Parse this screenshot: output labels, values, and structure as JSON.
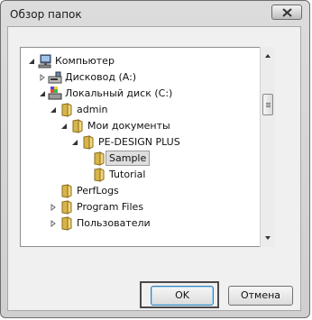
{
  "window": {
    "title": "Обзор папок",
    "close_icon": "close-icon"
  },
  "tree": {
    "items": [
      {
        "label": "Компьютер",
        "icon": "computer-icon",
        "expander": "expanded"
      },
      {
        "label": "Дисковод (A:)",
        "icon": "floppy-drive-icon",
        "expander": "collapsed"
      },
      {
        "label": "Локальный диск (C:)",
        "icon": "hard-drive-icon",
        "expander": "expanded"
      },
      {
        "label": "admin",
        "icon": "folder-icon",
        "expander": "expanded"
      },
      {
        "label": "Мои документы",
        "icon": "folder-icon",
        "expander": "expanded"
      },
      {
        "label": "PE-DESIGN PLUS",
        "icon": "folder-icon",
        "expander": "expanded"
      },
      {
        "label": "Sample",
        "icon": "folder-icon",
        "expander": "none",
        "selected": true
      },
      {
        "label": "Tutorial",
        "icon": "folder-icon",
        "expander": "none"
      },
      {
        "label": "PerfLogs",
        "icon": "folder-icon",
        "expander": "none"
      },
      {
        "label": "Program Files",
        "icon": "folder-icon",
        "expander": "collapsed"
      },
      {
        "label": "Пользователи",
        "icon": "folder-icon",
        "expander": "collapsed"
      }
    ]
  },
  "buttons": {
    "ok": "OK",
    "cancel": "Отмена"
  }
}
